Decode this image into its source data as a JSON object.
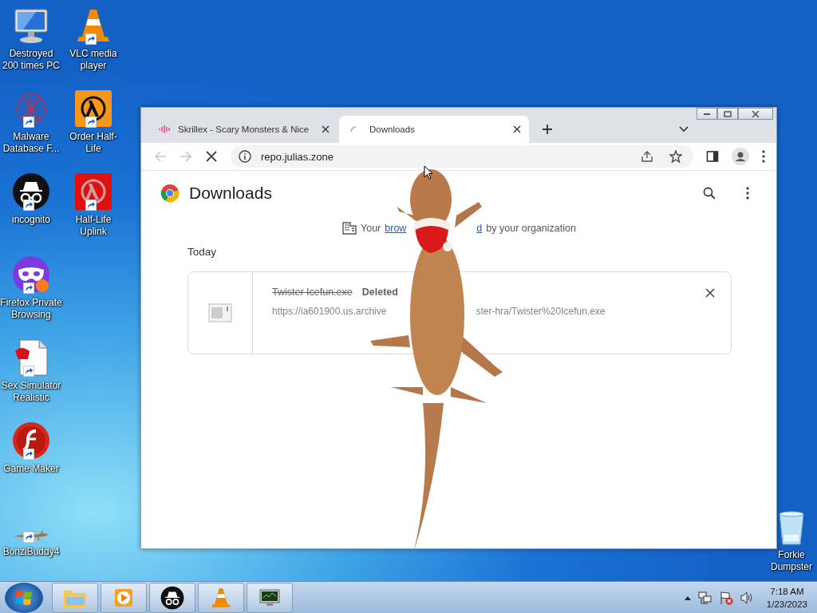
{
  "desktop_icons": [
    {
      "label": "Destroyed 200 times PC",
      "kind": "computer",
      "shortcut": false
    },
    {
      "label": "Malware Database F...",
      "kind": "malware",
      "shortcut": true
    },
    {
      "label": "incognito",
      "kind": "incognito",
      "shortcut": true
    },
    {
      "label": "Firefox Private Browsing",
      "kind": "mask",
      "shortcut": true
    },
    {
      "label": "Sex Simulator Realistic",
      "kind": "document",
      "shortcut": true
    },
    {
      "label": "Game Maker",
      "kind": "flash",
      "shortcut": true
    },
    {
      "label": "BonziBuddy4",
      "kind": "lizard",
      "shortcut": true
    },
    {
      "label": "VLC media player",
      "kind": "vlc",
      "shortcut": true
    },
    {
      "label": "Order Half-Life",
      "kind": "lambda-orange",
      "shortcut": true
    },
    {
      "label": "Half-Life Uplink",
      "kind": "lambda-red",
      "shortcut": true
    }
  ],
  "recycle_bin": {
    "label": "Forkie Dumpster"
  },
  "browser": {
    "tabs": [
      {
        "title": "Skrillex - Scary Monsters & Nice",
        "kind": "audio",
        "selected": false
      },
      {
        "title": "Downloads",
        "kind": "loading",
        "selected": true
      }
    ],
    "nav_buttons": [
      {
        "kind": "back",
        "disabled": true
      },
      {
        "kind": "forward",
        "disabled": true
      },
      {
        "kind": "stop",
        "disabled": false
      }
    ],
    "address": "repo.julias.zone",
    "page": {
      "title": "Downloads",
      "notice": [
        {
          "kind": "text",
          "text": "Your"
        },
        {
          "kind": "link",
          "text": "brow"
        },
        {
          "kind": "gap"
        },
        {
          "kind": "link",
          "text": "d"
        },
        {
          "kind": "text",
          "text": "by your organization"
        }
      ],
      "section": "Today",
      "downloads": [
        {
          "file_name": "Twister Icefun.exe",
          "status": "Deleted",
          "deleted": true,
          "url_parts": [
            "https://ia601900.us.archive",
            "ster-hra/Twister%20Icefun.exe"
          ]
        }
      ]
    }
  },
  "taskbar": {
    "apps": [
      {
        "kind": "explorer"
      },
      {
        "kind": "media"
      },
      {
        "kind": "incognito"
      },
      {
        "kind": "vlc"
      },
      {
        "kind": "monitor"
      }
    ],
    "time": "7:18 AM",
    "date": "1/23/2023"
  }
}
